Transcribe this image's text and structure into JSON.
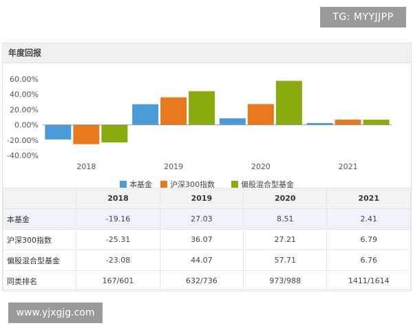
{
  "watermark_top": "TG: MYYJJPP",
  "watermark_bottom": "www.yjxgjg.com",
  "panel_title": "年度回报",
  "chart_data": {
    "type": "bar",
    "categories": [
      "2018",
      "2019",
      "2020",
      "2021"
    ],
    "series": [
      {
        "name": "本基金",
        "color": "#4a9bd6",
        "values": [
          -19.16,
          27.03,
          8.51,
          2.41
        ]
      },
      {
        "name": "沪深300指数",
        "color": "#e8791e",
        "values": [
          -25.31,
          36.07,
          27.21,
          6.79
        ]
      },
      {
        "name": "偏股混合型基金",
        "color": "#8aab0e",
        "values": [
          -23.08,
          44.07,
          57.71,
          6.76
        ]
      }
    ],
    "ylim": [
      -40,
      60
    ],
    "yticks": [
      "60.00%",
      "40.00%",
      "20.00%",
      "0.00%",
      "-20.00%",
      "-40.00%"
    ],
    "ytick_values": [
      60,
      40,
      20,
      0,
      -20,
      -40
    ],
    "legend": "bottom",
    "grid": false
  },
  "table": {
    "headers": [
      "",
      "2018",
      "2019",
      "2020",
      "2021"
    ],
    "rows": [
      {
        "label": "本基金",
        "values": [
          "-19.16",
          "27.03",
          "8.51",
          "2.41"
        ]
      },
      {
        "label": "沪深300指数",
        "values": [
          "-25.31",
          "36.07",
          "27.21",
          "6.79"
        ]
      },
      {
        "label": "偏股混合型基金",
        "values": [
          "-23.08",
          "44.07",
          "57.71",
          "6.76"
        ]
      },
      {
        "label": "同类排名",
        "values": [
          "167/601",
          "632/736",
          "973/988",
          "1411/1614"
        ]
      }
    ]
  }
}
